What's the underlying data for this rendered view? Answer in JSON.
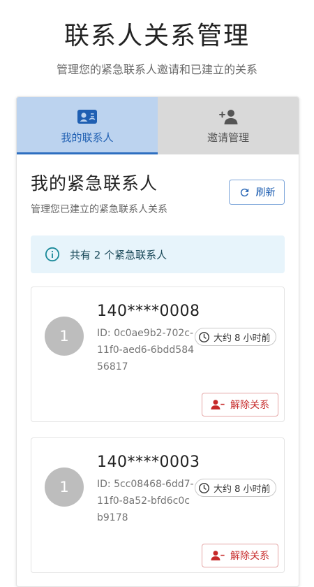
{
  "header": {
    "title": "联系人关系管理",
    "subtitle": "管理您的紧急联系人邀请和已建立的关系"
  },
  "tabs": [
    {
      "label": "我的联系人",
      "icon": "contacts-icon",
      "active": true
    },
    {
      "label": "邀请管理",
      "icon": "person-add-icon",
      "active": false
    }
  ],
  "section": {
    "title": "我的紧急联系人",
    "subtitle": "管理您已建立的紧急联系人关系",
    "refresh_label": "刷新"
  },
  "info": {
    "text": "共有 2 个紧急联系人",
    "icon": "info-icon"
  },
  "contacts": [
    {
      "avatar": "1",
      "phone": "140****0008",
      "id_text": "ID: 0c0ae9b2-702c-11f0-aed6-6bdd58456817",
      "time": "大约 8 小时前",
      "remove_label": "解除关系"
    },
    {
      "avatar": "1",
      "phone": "140****0003",
      "id_text": "ID: 5cc08468-6dd7-11f0-8a52-bfd6c0cb9178",
      "time": "大约 8 小时前",
      "remove_label": "解除关系"
    }
  ],
  "colors": {
    "primary": "#1f5fb2",
    "active_tab_bg": "#bcd3ef",
    "inactive_tab_bg": "#d9d9d9",
    "info_bg": "#e7f4fb",
    "info_icon": "#1b8a9a",
    "danger": "#c62828",
    "avatar_bg": "#bdbdbd"
  }
}
